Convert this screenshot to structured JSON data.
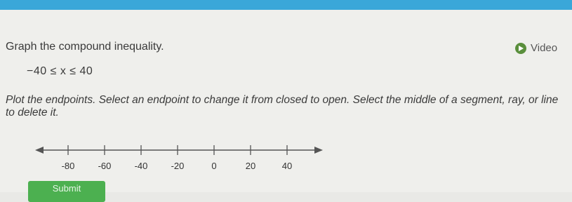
{
  "header": {
    "accent_color": "#3aa7d9"
  },
  "question": {
    "prompt": "Graph the compound inequality.",
    "inequality": "−40 ≤ x ≤ 40",
    "instructions": "Plot the endpoints. Select an endpoint to change it from closed to open. Select the middle of a segment, ray, or line to delete it."
  },
  "video": {
    "label": "Video",
    "icon": "play-icon"
  },
  "number_line": {
    "tick_labels": [
      "-80",
      "-60",
      "-40",
      "-20",
      "0",
      "20",
      "40"
    ],
    "tick_values": [
      -80,
      -60,
      -40,
      -20,
      0,
      20,
      40
    ]
  },
  "submit": {
    "label": "Submit",
    "color": "#4cb050"
  }
}
